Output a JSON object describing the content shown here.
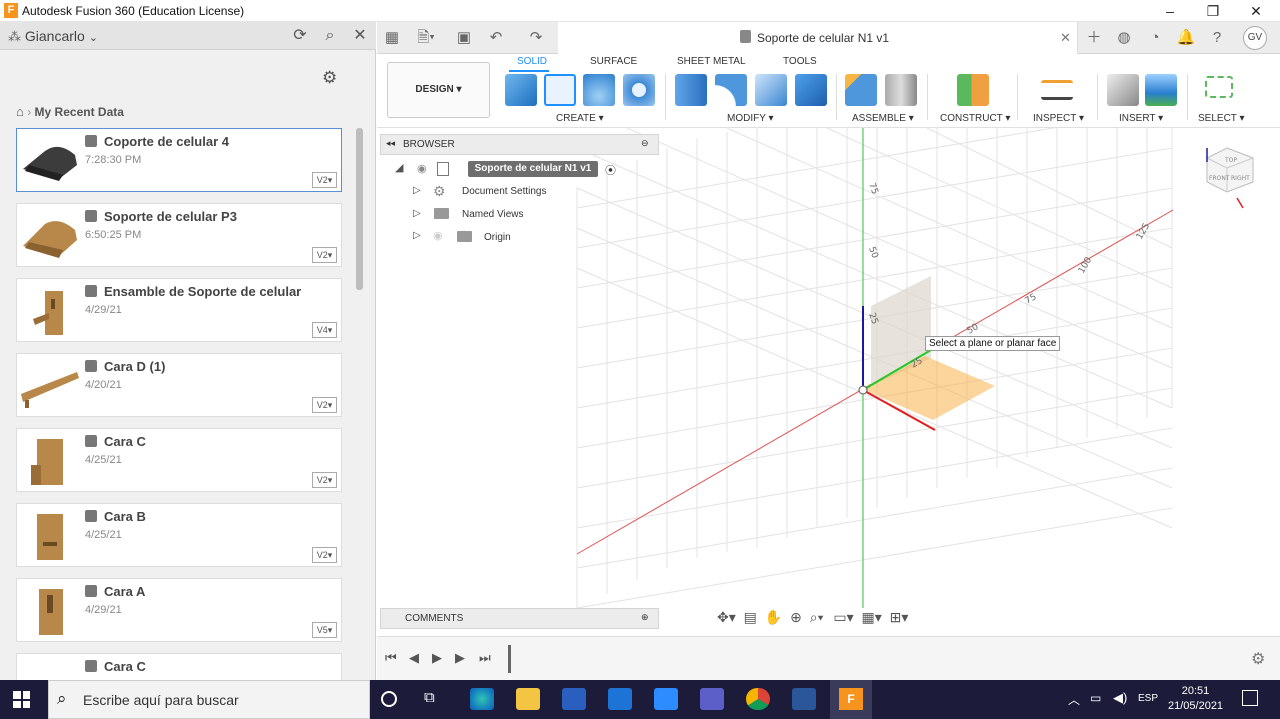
{
  "window": {
    "title": "Autodesk Fusion 360 (Education License)",
    "logo_letter": "F"
  },
  "data_panel": {
    "user": "Giancarlo",
    "breadcrumb": "My Recent Data",
    "items": [
      {
        "name": "Coporte de celular 4",
        "date": "7:28:30 PM",
        "version": "V2▾"
      },
      {
        "name": "Soporte de celular P3",
        "date": "6:50:25 PM",
        "version": "V2▾"
      },
      {
        "name": "Ensamble de Soporte de celular",
        "date": "4/29/21",
        "version": "V4▾"
      },
      {
        "name": "Cara D (1)",
        "date": "4/20/21",
        "version": "V2▾"
      },
      {
        "name": "Cara C",
        "date": "4/25/21",
        "version": "V2▾"
      },
      {
        "name": "Cara B",
        "date": "4/25/21",
        "version": "V2▾"
      },
      {
        "name": "Cara A",
        "date": "4/29/21",
        "version": "V5▾"
      },
      {
        "name": "Cara C",
        "date": "",
        "version": ""
      }
    ]
  },
  "document_tab": {
    "title": "Soporte de celular N1 v1",
    "user_initials": "GV"
  },
  "toolbar": {
    "workspace": "DESIGN ▾",
    "tabs": [
      "SOLID",
      "SURFACE",
      "SHEET METAL",
      "TOOLS"
    ],
    "active_tab": "SOLID",
    "groups": [
      "CREATE ▾",
      "MODIFY ▾",
      "ASSEMBLE ▾",
      "CONSTRUCT ▾",
      "INSPECT ▾",
      "INSERT ▾",
      "SELECT ▾"
    ]
  },
  "browser": {
    "title": "BROWSER",
    "root": "Soporte de celular N1 v1",
    "nodes": [
      "Document Settings",
      "Named Views",
      "Origin"
    ]
  },
  "comments": {
    "title": "COMMENTS"
  },
  "viewport": {
    "tooltip": "Select a plane or planar face",
    "axis_labels": [
      "75",
      "50",
      "25",
      "25",
      "50",
      "75",
      "100",
      "125"
    ],
    "colors": {
      "x_axis": "#e02020",
      "y_axis": "#22aa22",
      "z_axis": "#1a1aa0",
      "plane": "#f7b34a"
    },
    "viewcube": {
      "top": "TOP",
      "front": "FRONT",
      "right": "RIGHT"
    }
  },
  "taskbar": {
    "search_placeholder": "Escribe aquí para buscar",
    "language": "ESP",
    "time": "20:51",
    "date": "21/05/2021"
  }
}
